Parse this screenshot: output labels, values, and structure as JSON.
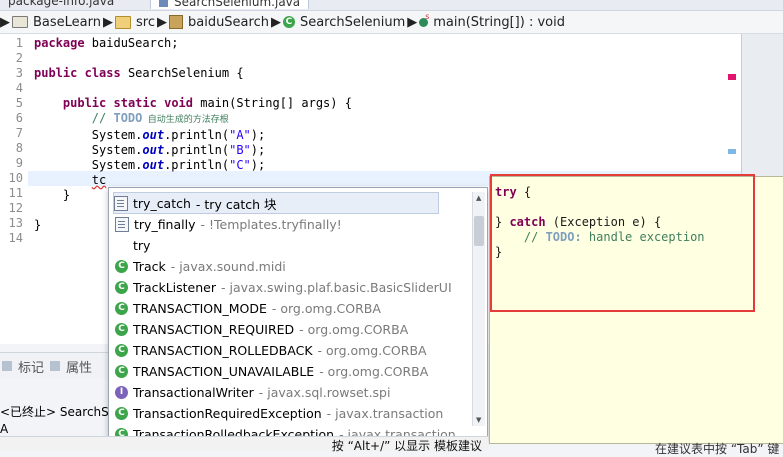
{
  "tabs": [
    "package-info.java",
    "SearchSelenium.java"
  ],
  "breadcrumb": [
    {
      "label": "BaseLearn",
      "icon": "project-icon"
    },
    {
      "label": "src",
      "icon": "source-folder-icon"
    },
    {
      "label": "baiduSearch",
      "icon": "package-icon"
    },
    {
      "label": "SearchSelenium",
      "icon": "class-icon"
    },
    {
      "label": "main(String[]) : void",
      "icon": "method-icon"
    }
  ],
  "editor": {
    "line_numbers": [
      "1",
      "2",
      "3",
      "4",
      "5",
      "6",
      "7",
      "8",
      "9",
      "10",
      "11",
      "12",
      "13",
      "14"
    ],
    "code": {
      "l1_kw": "package",
      "l1_rest": " baiduSearch;",
      "l3_kw1": "public",
      "l3_kw2": "class",
      "l3_rest": " SearchSelenium {",
      "l5_kw1": "public",
      "l5_kw2": "static",
      "l5_kw3": "void",
      "l5_rest": " main(String[] args) {",
      "l6_c1": "// ",
      "l6_todo": "TODO",
      "l6_c2": " 自动生成的方法存根",
      "l7_a": "System.",
      "l7_out": "out",
      "l7_b": ".println(",
      "l7_s": "\"A\"",
      "l7_c": ");",
      "l8_a": "System.",
      "l8_out": "out",
      "l8_b": ".println(",
      "l8_s": "\"B\"",
      "l8_c": ");",
      "l9_a": "System.",
      "l9_out": "out",
      "l9_b": ".println(",
      "l9_s": "\"C\"",
      "l9_c": ");",
      "l10": "tc",
      "l11": "}",
      "l13": "}"
    }
  },
  "bottom_panel": {
    "tabs": [
      "标记",
      "属性"
    ],
    "console_line1": "<已终止> SearchSe",
    "console_line2": "A"
  },
  "completion": {
    "items": [
      {
        "name": "try_catch",
        "qual": " - try catch 块",
        "icon": "template-icon"
      },
      {
        "name": "try_finally",
        "qual": " - !Templates.tryfinally!",
        "icon": "template-icon"
      },
      {
        "name": "try",
        "qual": "",
        "icon": "blank"
      },
      {
        "name": "Track",
        "qual": " - javax.sound.midi",
        "icon": "class-icon"
      },
      {
        "name": "TrackListener",
        "qual": " - javax.swing.plaf.basic.BasicSliderUI",
        "icon": "class-icon"
      },
      {
        "name": "TRANSACTION_MODE",
        "qual": " - org.omg.CORBA",
        "icon": "class-icon"
      },
      {
        "name": "TRANSACTION_REQUIRED",
        "qual": " - org.omg.CORBA",
        "icon": "class-icon"
      },
      {
        "name": "TRANSACTION_ROLLEDBACK",
        "qual": " - org.omg.CORBA",
        "icon": "class-icon"
      },
      {
        "name": "TRANSACTION_UNAVAILABLE",
        "qual": " - org.omg.CORBA",
        "icon": "class-icon"
      },
      {
        "name": "TransactionalWriter",
        "qual": " - javax.sql.rowset.spi",
        "icon": "interface-icon"
      },
      {
        "name": "TransactionRequiredException",
        "qual": " - javax.transaction",
        "icon": "class-icon"
      },
      {
        "name": "TransactionRolledbackException",
        "qual": " - javax.transaction",
        "icon": "class-icon"
      }
    ],
    "footer": "按 “Alt+/” 以显示 模板建议"
  },
  "info": {
    "l1_kw": "try",
    "l1_rest": " {",
    "l3_a": "} ",
    "l3_kw": "catch",
    "l3_rest": " (Exception e) {",
    "l4_c": "    // ",
    "l4_todo": "TODO:",
    "l4_rest": " handle exception",
    "l5": "}",
    "footer": "在建议表中按 “Tab” 键"
  }
}
